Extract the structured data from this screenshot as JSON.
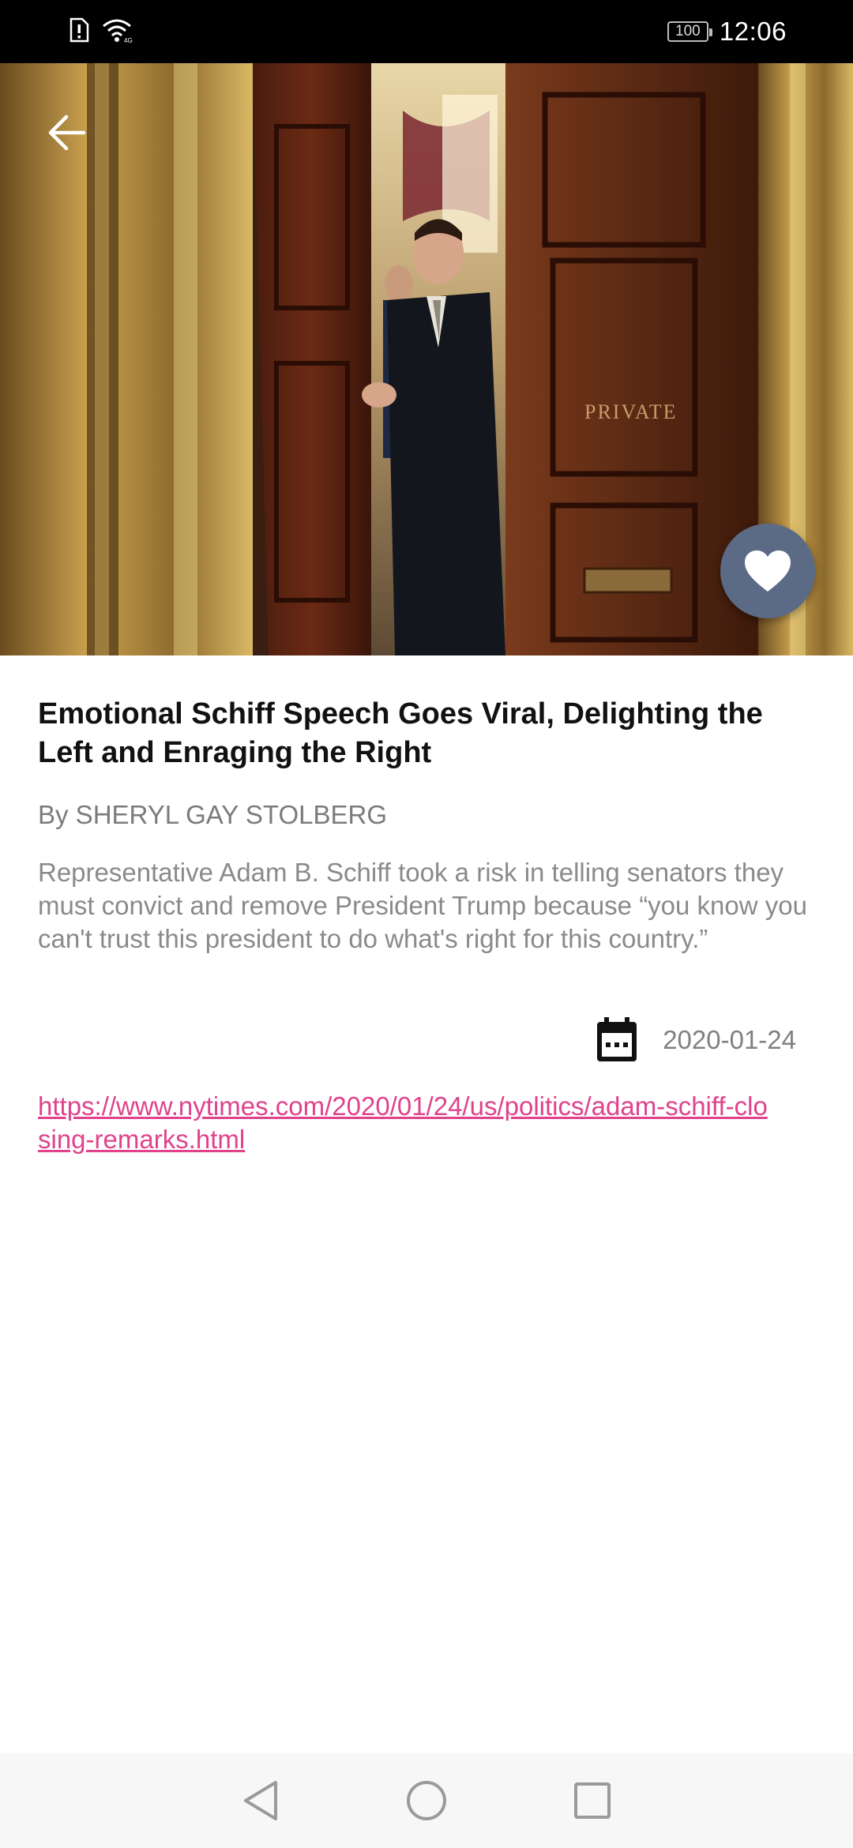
{
  "status_bar": {
    "left_icons": [
      "sim-alert-icon",
      "wifi-icon"
    ],
    "battery_level": "100",
    "time": "12:06"
  },
  "hero": {
    "image_description_icon": "photo",
    "door_sign": "PRIVATE",
    "back_icon": "arrow-left-icon",
    "favorite_icon": "heart-icon",
    "favorite_button_color": "#5b6b86"
  },
  "article": {
    "title": "Emotional Schiff Speech Goes Viral, Delighting the Left and Enraging the Right",
    "byline": "By SHERYL GAY STOLBERG",
    "summary": "Representative Adam B. Schiff took a risk in telling senators they must convict and remove President Trump because “you know you can't trust this president to do what's right for this country.”",
    "date_icon": "calendar-icon",
    "date": "2020-01-24",
    "url": "https://www.nytimes.com/2020/01/24/us/politics/adam-schiff-closing-remarks.html",
    "link_color": "#e0428c"
  },
  "nav_bar": {
    "buttons": [
      "back-triangle-icon",
      "home-circle-icon",
      "recents-square-icon"
    ]
  }
}
